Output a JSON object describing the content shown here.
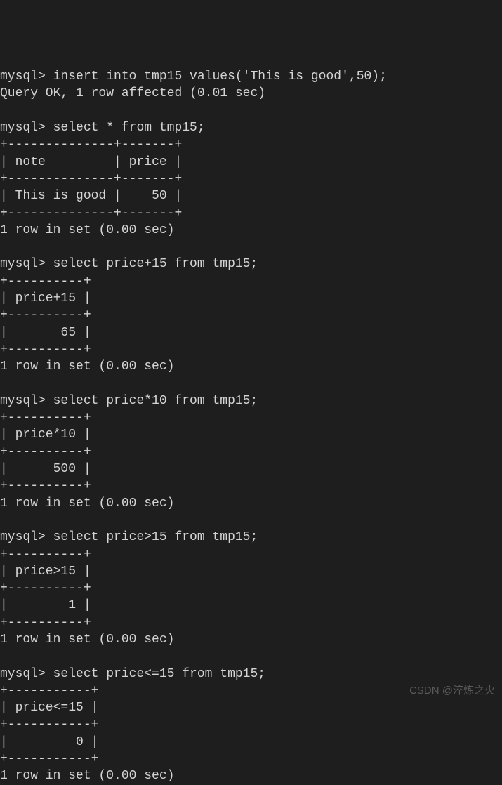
{
  "prompt": "mysql>",
  "commands": {
    "insert": "insert into tmp15 values('This is good',50);",
    "insert_result": "Query OK, 1 row affected (0.01 sec)",
    "select_all": "select * from tmp15;",
    "select_plus": "select price+15 from tmp15;",
    "select_mult": "select price*10 from tmp15;",
    "select_gt": "select price>15 from tmp15;",
    "select_lte": "select price<=15 from tmp15;"
  },
  "tables": {
    "all": {
      "border_top": "+--------------+-------+",
      "header": "| note         | price |",
      "row": "| This is good |    50 |",
      "footer": "1 row in set (0.00 sec)"
    },
    "plus": {
      "border": "+----------+",
      "header": "| price+15 |",
      "row": "|       65 |",
      "footer": "1 row in set (0.00 sec)"
    },
    "mult": {
      "border": "+----------+",
      "header": "| price*10 |",
      "row": "|      500 |",
      "footer": "1 row in set (0.00 sec)"
    },
    "gt": {
      "border": "+----------+",
      "header": "| price>15 |",
      "row": "|        1 |",
      "footer": "1 row in set (0.00 sec)"
    },
    "lte": {
      "border": "+-----------+",
      "header": "| price<=15 |",
      "row": "|         0 |",
      "footer": "1 row in set (0.00 sec)"
    }
  },
  "watermark": "CSDN @淬炼之火"
}
